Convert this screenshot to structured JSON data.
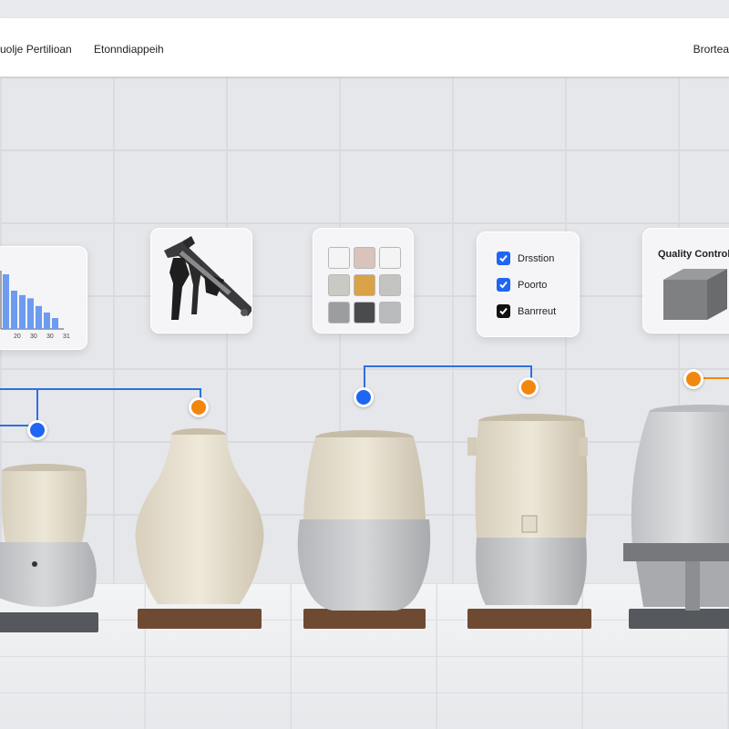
{
  "header": {
    "title": "uolje Pertilioan",
    "subtitle": "Etonndiappeih",
    "right_label": "Brortea"
  },
  "cards": {
    "chart": {
      "bar_values": [
        100,
        70,
        62,
        56,
        42,
        30,
        20
      ],
      "tick_labels": [
        "20",
        "30",
        "30",
        "31"
      ]
    },
    "caliper": {
      "icon": "caliper-icon"
    },
    "swatches": {
      "colors": [
        "#f4f4f4",
        "#d9c3ba",
        "#f4f4f4",
        "#c9cac4",
        "#d9a246",
        "#c3c4c1",
        "#9c9d9e",
        "#4a4b4d",
        "#b9babb"
      ]
    },
    "checklist": {
      "items": [
        {
          "label": "Drsstion",
          "checked": true,
          "color": "#1f66f2"
        },
        {
          "label": "Poorto",
          "checked": true,
          "color": "#1f66f2"
        },
        {
          "label": "Banrreut",
          "checked": true,
          "color": "#111111"
        }
      ]
    },
    "qc": {
      "title": "Quality Control",
      "icon": "concrete-block-icon"
    }
  },
  "colors": {
    "connector_blue": "#2f6fde",
    "marker_blue": "#1f66f2",
    "marker_orange": "#f2870f",
    "ceramic": "#e6dfcf",
    "concrete": "#c9cacc"
  }
}
